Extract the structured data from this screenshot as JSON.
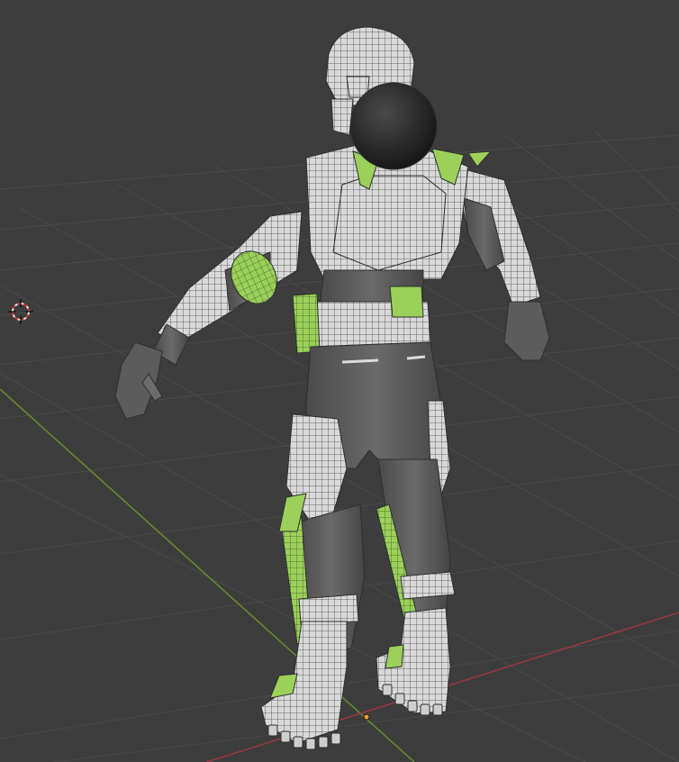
{
  "viewport": {
    "background": "#3d3d3d",
    "grid_color": "#4a4a4a",
    "x_axis_color": "#9a3a44",
    "y_axis_color": "#6a8e2e",
    "selection_color": "#8fd14f",
    "mesh_color": "#d8d8d8",
    "wire_color": "#3a3a3a",
    "suit_dark_color": "#5a5a5a",
    "helmet_visor_color": "#1e1e1e",
    "origin_color": "#f0a020"
  },
  "objects": {
    "model": "character-mesh",
    "cursor": "3d-cursor-icon"
  }
}
